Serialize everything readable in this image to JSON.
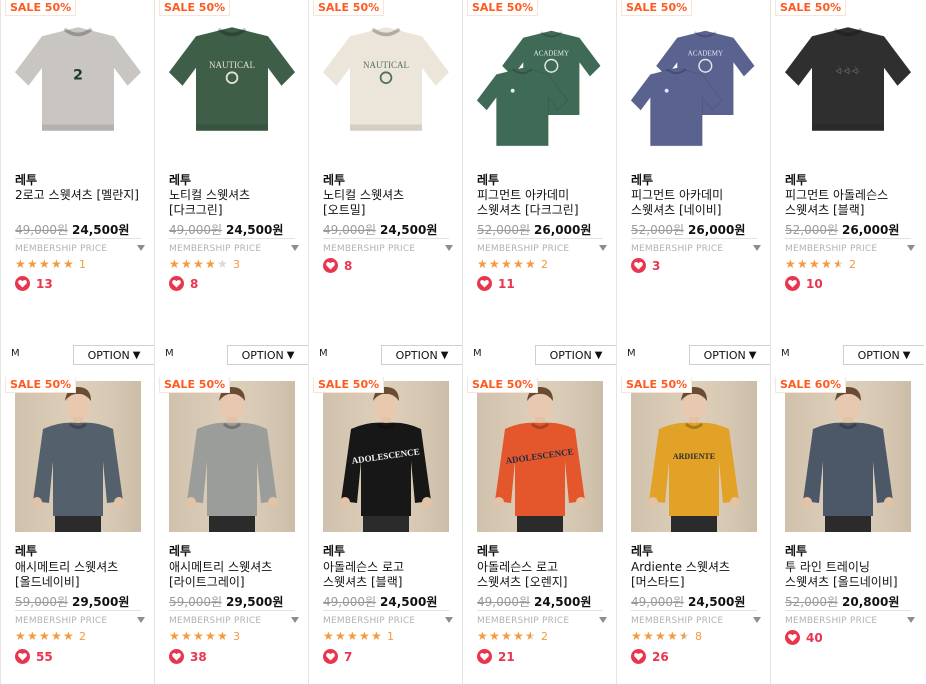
{
  "products": [
    {
      "badge": "SALE 50%",
      "brand": "레투",
      "name": "2로고 스웻셔츠 [멜란지]",
      "original_price": "49,000원",
      "sale_price": "24,500원",
      "membership_label": "MEMBERSHIP PRICE",
      "rating": 5,
      "reviews": "1",
      "likes": "13",
      "image": "sweatshirt-gray-2-logo",
      "photo_colors": {
        "body": "#c9c6c2",
        "accent": "#1d3b2f"
      },
      "size_code": "M",
      "option_label": "OPTION"
    },
    {
      "badge": "SALE 50%",
      "brand": "레투",
      "name": "노티컬 스웻셔츠 [다크그린]",
      "original_price": "49,000원",
      "sale_price": "24,500원",
      "membership_label": "MEMBERSHIP PRICE",
      "rating": 4,
      "reviews": "3",
      "likes": "8",
      "image": "sweatshirt-darkgreen-nautical",
      "photo_colors": {
        "body": "#3e5e48",
        "accent": "#e6e2d9"
      },
      "size_code": "M",
      "option_label": "OPTION"
    },
    {
      "badge": "SALE 50%",
      "brand": "레투",
      "name": "노티컬 스웻셔츠 [오트밀]",
      "original_price": "49,000원",
      "sale_price": "24,500원",
      "membership_label": "MEMBERSHIP PRICE",
      "rating": 0,
      "reviews": "",
      "likes": "8",
      "image": "sweatshirt-oatmeal-nautical",
      "photo_colors": {
        "body": "#ece6da",
        "accent": "#53705f"
      },
      "size_code": "M",
      "option_label": "OPTION"
    },
    {
      "badge": "SALE 50%",
      "brand": "레투",
      "name": "피그먼트 아카데미 스웻셔츠 [다크그린]",
      "original_price": "52,000원",
      "sale_price": "26,000원",
      "membership_label": "MEMBERSHIP PRICE",
      "rating": 5,
      "reviews": "2",
      "likes": "11",
      "image": "sweatshirt-green-academy-pair",
      "photo_colors": {
        "body": "#3f6a56",
        "accent": "#e7efe9"
      },
      "size_code": "M",
      "option_label": "OPTION"
    },
    {
      "badge": "SALE 50%",
      "brand": "레투",
      "name": "피그먼트 아카데미 스웻셔츠 [네이비]",
      "original_price": "52,000원",
      "sale_price": "26,000원",
      "membership_label": "MEMBERSHIP PRICE",
      "rating": 0,
      "reviews": "",
      "likes": "3",
      "image": "sweatshirt-navy-academy-pair",
      "photo_colors": {
        "body": "#5a6290",
        "accent": "#e4e6f0"
      },
      "size_code": "M",
      "option_label": "OPTION"
    },
    {
      "badge": "SALE 50%",
      "brand": "레투",
      "name": "피그먼트 아돌레슨스 스웻셔츠 [블랙]",
      "original_price": "52,000원",
      "sale_price": "26,000원",
      "membership_label": "MEMBERSHIP PRICE",
      "rating": 4.5,
      "reviews": "2",
      "likes": "10",
      "image": "sweatshirt-black-adolescence",
      "photo_colors": {
        "body": "#2f2f2f",
        "accent": "#6a6a6a"
      },
      "size_code": "M",
      "option_label": "OPTION"
    },
    {
      "badge": "SALE 50%",
      "brand": "레투",
      "name": "애시메트리 스웻셔츠 [올드네이비]",
      "original_price": "59,000원",
      "sale_price": "29,500원",
      "membership_label": "MEMBERSHIP PRICE",
      "rating": 5,
      "reviews": "2",
      "likes": "55",
      "image": "model-oldnavy-asymmetry",
      "photo_colors": {
        "body": "#55606d",
        "accent": "#2f2b2a"
      },
      "size_code": "",
      "option_label": ""
    },
    {
      "badge": "SALE 50%",
      "brand": "레투",
      "name": "애시메트리 스웻셔츠 [라이트그레이]",
      "original_price": "59,000원",
      "sale_price": "29,500원",
      "membership_label": "MEMBERSHIP PRICE",
      "rating": 5,
      "reviews": "3",
      "likes": "38",
      "image": "model-lightgray-asymmetry",
      "photo_colors": {
        "body": "#9b9d9a",
        "accent": "#3a4a60"
      },
      "size_code": "",
      "option_label": ""
    },
    {
      "badge": "SALE 50%",
      "brand": "레투",
      "name": "아돌레슨스 로고 스웻셔츠 [블랙]",
      "original_price": "49,000원",
      "sale_price": "24,500원",
      "membership_label": "MEMBERSHIP PRICE",
      "rating": 5,
      "reviews": "1",
      "likes": "7",
      "image": "model-black-adolescence-logo",
      "photo_colors": {
        "body": "#171717",
        "accent": "#f1f1f1"
      },
      "size_code": "",
      "option_label": ""
    },
    {
      "badge": "SALE 50%",
      "brand": "레투",
      "name": "아돌레슨스 로고 스웻셔츠 [오렌지]",
      "original_price": "49,000원",
      "sale_price": "24,500원",
      "membership_label": "MEMBERSHIP PRICE",
      "rating": 4.5,
      "reviews": "2",
      "likes": "21",
      "image": "model-orange-adolescence-logo",
      "photo_colors": {
        "body": "#e4572c",
        "accent": "#1e2b45"
      },
      "size_code": "",
      "option_label": ""
    },
    {
      "badge": "SALE 50%",
      "brand": "레투",
      "name": "Ardiente 스웻셔츠 [머스타드]",
      "original_price": "49,000원",
      "sale_price": "24,500원",
      "membership_label": "MEMBERSHIP PRICE",
      "rating": 4.5,
      "reviews": "8",
      "likes": "26",
      "image": "model-mustard-ardiente",
      "photo_colors": {
        "body": "#e1a227",
        "accent": "#2c2c2c"
      },
      "size_code": "",
      "option_label": ""
    },
    {
      "badge": "SALE 60%",
      "brand": "레투",
      "name": "투 라인 트레이닝 스웻셔츠 [올드네이비]",
      "original_price": "52,000원",
      "sale_price": "20,800원",
      "membership_label": "MEMBERSHIP PRICE",
      "rating": 0,
      "reviews": "",
      "likes": "40",
      "image": "model-oldnavy-two-line",
      "photo_colors": {
        "body": "#4c5868",
        "accent": "#9aa4b4"
      },
      "size_code": "",
      "option_label": ""
    }
  ],
  "colors": {
    "sale_accent": "#ff5a1f",
    "heart": "#e9364f",
    "star": "#f29a3c",
    "muted_text": "#9a9a9a",
    "studio_bg": "#dccdb6"
  }
}
